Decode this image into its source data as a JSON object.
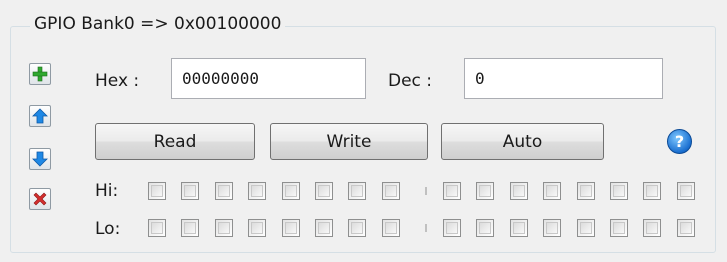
{
  "window": {
    "group_title": "GPIO Bank0 => 0x00100000"
  },
  "side_toolbar": {
    "icons": [
      "plus-icon",
      "arrow-up-icon",
      "arrow-down-icon",
      "delete-icon"
    ],
    "colors": {
      "plus": "#2fa82f",
      "arrows": "#1e88e5",
      "delete": "#d32f2f"
    }
  },
  "hex": {
    "label": "Hex :",
    "value": "00000000"
  },
  "dec": {
    "label": "Dec :",
    "value": "0"
  },
  "buttons": {
    "read": "Read",
    "write": "Write",
    "auto": "Auto",
    "help": "?"
  },
  "bits": {
    "hi_label": "Hi:",
    "lo_label": "Lo:",
    "hi": [
      false,
      false,
      false,
      false,
      false,
      false,
      false,
      false,
      false,
      false,
      false,
      false,
      false,
      false,
      false,
      false
    ],
    "lo": [
      false,
      false,
      false,
      false,
      false,
      false,
      false,
      false,
      false,
      false,
      false,
      false,
      false,
      false,
      false,
      false
    ]
  }
}
